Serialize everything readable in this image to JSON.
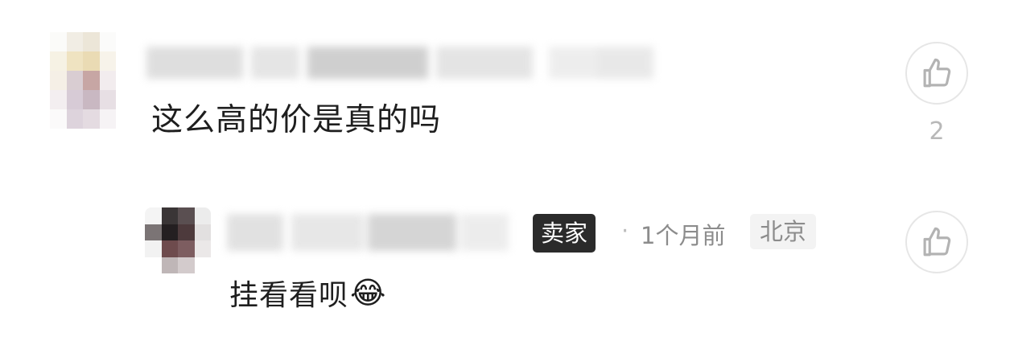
{
  "comment": {
    "text": "这么高的价是真的吗",
    "likes": "2"
  },
  "reply": {
    "badge": "卖家",
    "time": "1个月前",
    "location": "北京",
    "text": "挂看看呗",
    "emoji": "😂"
  },
  "icons": {
    "like": "thumbs-up-icon"
  }
}
